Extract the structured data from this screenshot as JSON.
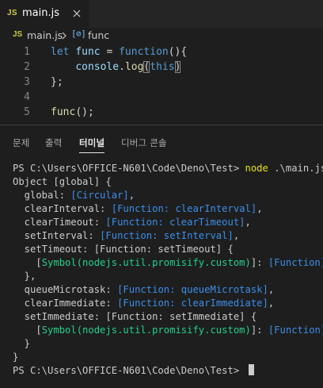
{
  "tab": {
    "icon_label": "JS",
    "title": "main.js",
    "close_glyph": "×"
  },
  "breadcrumb": {
    "icon_label": "JS",
    "file": "main.js",
    "symbol_icon": "[⊘]",
    "symbol": "func"
  },
  "editor": {
    "line_numbers": [
      "1",
      "2",
      "3",
      "4",
      "5"
    ],
    "lines": {
      "l1": {
        "kw": "let",
        "var": "func",
        "eq": " = ",
        "kw2": "function",
        "rest": "(){"
      },
      "l2": {
        "var": "console",
        "dot": ".",
        "fn": "log",
        "open": "(",
        "kw": "this",
        "close": ")"
      },
      "l3": {
        "text": "};"
      },
      "l5": {
        "fn": "func",
        "rest": "();"
      }
    }
  },
  "panel": {
    "tabs": [
      "문제",
      "출력",
      "터미널",
      "디버그 콘솔"
    ],
    "active_tab": "터미널"
  },
  "terminal": {
    "prompt": "PS C:\\Users\\OFFICE-N601\\Code\\Deno\\Test> ",
    "command": "node",
    "command_arg": " .\\main.js",
    "output": {
      "l1": "Object [global] {",
      "l2": {
        "key": "  global: ",
        "val": "[Circular]",
        "tail": ","
      },
      "l3": {
        "key": "  clearInterval: ",
        "val": "[Function: clearInterval]",
        "tail": ","
      },
      "l4": {
        "key": "  clearTimeout: ",
        "val": "[Function: clearTimeout]",
        "tail": ","
      },
      "l5": {
        "key": "  setInterval: ",
        "val": "[Function: setInterval]",
        "tail": ","
      },
      "l6": "  setTimeout: [Function: setTimeout] {",
      "l7": {
        "pre": "    [",
        "sym": "Symbol(nodejs.util.promisify.custom)",
        "mid": "]: ",
        "val": "[Function]"
      },
      "l8": "  },",
      "l9": {
        "key": "  queueMicrotask: ",
        "val": "[Function: queueMicrotask]",
        "tail": ","
      },
      "l10": {
        "key": "  clearImmediate: ",
        "val": "[Function: clearImmediate]",
        "tail": ","
      },
      "l11": "  setImmediate: [Function: setImmediate] {",
      "l12": {
        "pre": "    [",
        "sym": "Symbol(nodejs.util.promisify.custom)",
        "mid": "]: ",
        "val": "[Function]"
      },
      "l13": "  }",
      "l14": "}"
    },
    "final_prompt": "PS C:\\Users\\OFFICE-N601\\Code\\Deno\\Test> "
  },
  "colors": {
    "background": "#1e1e1e",
    "keyword": "#569cd6",
    "variable": "#9cdcfe",
    "function": "#dcdcaa",
    "terminal_blue": "#3b8eea",
    "terminal_green": "#23d18b",
    "terminal_yellow": "#e5e510",
    "js_icon": "#cbcb41"
  }
}
